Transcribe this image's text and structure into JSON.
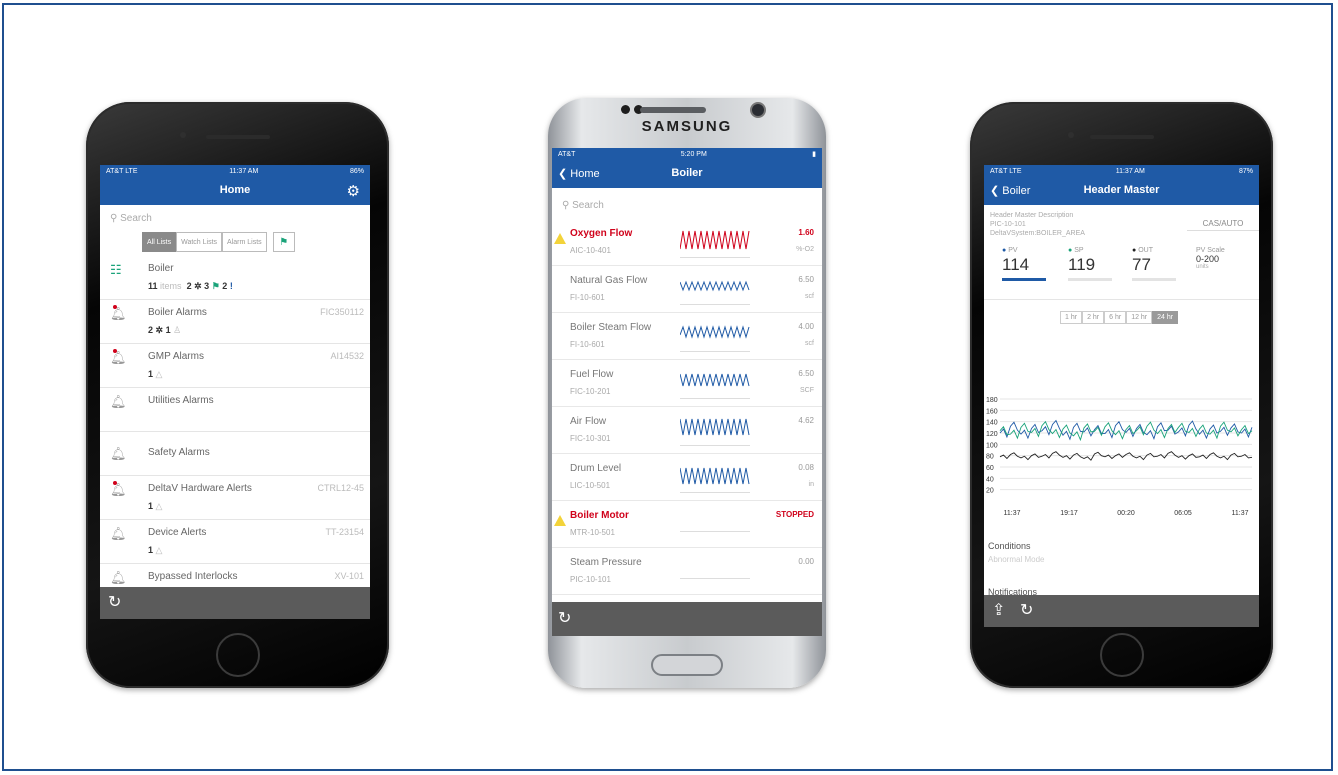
{
  "phone1": {
    "status": {
      "carrier": "AT&T LTE",
      "time": "11:37 AM",
      "battery": "86%"
    },
    "nav": {
      "title": "Home"
    },
    "search_placeholder": "Search",
    "tabs": [
      "All Lists",
      "Watch Lists",
      "Alarm Lists"
    ],
    "items": [
      {
        "name": "Boiler",
        "tag": "",
        "count": "11",
        "count_label": "items",
        "s1": "2",
        "s2": "3",
        "s3": "2"
      },
      {
        "name": "Boiler Alarms",
        "tag": "FIC350112",
        "s1": "2",
        "s2": "1"
      },
      {
        "name": "GMP Alarms",
        "tag": "AI14532",
        "s1": "1"
      },
      {
        "name": "Utilities Alarms",
        "tag": ""
      },
      {
        "name": "Safety Alarms",
        "tag": ""
      },
      {
        "name": "DeltaV Hardware Alerts",
        "tag": "CTRL12-45",
        "s1": "1"
      },
      {
        "name": "Device Alerts",
        "tag": "TT-23154",
        "s1": "1"
      },
      {
        "name": "Bypassed Interlocks",
        "tag": "XV-101"
      }
    ]
  },
  "phone2": {
    "brand": "SAMSUNG",
    "status": {
      "carrier": "AT&T",
      "time": "5:20 PM"
    },
    "nav": {
      "back": "Home",
      "title": "Boiler"
    },
    "search_placeholder": "Search",
    "rows": [
      {
        "name": "Oxygen Flow",
        "tag": "AIC-10-401",
        "value": "1.60",
        "unit": "%-O2",
        "alarm": true
      },
      {
        "name": "Natural Gas Flow",
        "tag": "FI-10-601",
        "value": "6.50",
        "unit": "scf"
      },
      {
        "name": "Boiler Steam Flow",
        "tag": "FI-10-601",
        "value": "4.00",
        "unit": "scf"
      },
      {
        "name": "Fuel Flow",
        "tag": "FIC-10-201",
        "value": "6.50",
        "unit": "SCF"
      },
      {
        "name": "Air Flow",
        "tag": "FIC-10-301",
        "value": "4.62",
        "unit": ""
      },
      {
        "name": "Drum Level",
        "tag": "LIC-10-501",
        "value": "0.08",
        "unit": "in"
      },
      {
        "name": "Boiler Motor",
        "tag": "MTR-10-501",
        "value": "STOPPED",
        "unit": "",
        "alarm": true
      },
      {
        "name": "Steam Pressure",
        "tag": "PIC-10-101",
        "value": "0.00",
        "unit": ""
      }
    ]
  },
  "phone3": {
    "status": {
      "carrier": "AT&T LTE",
      "time": "11:37 AM",
      "battery": "87%"
    },
    "nav": {
      "back": "Boiler",
      "title": "Header Master"
    },
    "desc": [
      "Header Master Description",
      "PIC-10-101",
      "DeltaVSystem:BOILER_AREA"
    ],
    "mode": "CAS/AUTO",
    "pv": {
      "label": "PV",
      "value": "114"
    },
    "sp": {
      "label": "SP",
      "value": "119"
    },
    "out": {
      "label": "OUT",
      "value": "77"
    },
    "scale": {
      "label": "PV Scale",
      "value": "0-200",
      "unit": "units"
    },
    "ranges": [
      "1 hr",
      "2 hr",
      "6 hr",
      "12 hr",
      "24 hr"
    ],
    "chart_data": {
      "type": "line",
      "y_ticks": [
        "180",
        "160",
        "140",
        "120",
        "100",
        "80",
        "60",
        "40",
        "20"
      ],
      "x_ticks": [
        "11:37",
        "19:17",
        "00:20",
        "06:05",
        "11:37"
      ],
      "ylim": [
        0,
        180
      ],
      "series": [
        {
          "values": [
            120,
            132,
            118,
            128,
            124,
            135,
            116,
            130,
            122,
            126,
            119,
            133,
            121,
            128,
            117,
            131,
            125,
            122,
            134,
            118,
            127,
            123,
            129,
            120,
            130
          ]
        },
        {
          "values": [
            124,
            118,
            130,
            121,
            133,
            119,
            127,
            115,
            129,
            123,
            131,
            117,
            126,
            124,
            132,
            119,
            128,
            130,
            121,
            127,
            118,
            132,
            122,
            126,
            124
          ]
        },
        {
          "values": [
            78,
            82,
            76,
            80,
            79,
            84,
            77,
            81,
            75,
            83,
            78,
            80,
            82,
            76,
            81,
            79,
            84,
            77,
            80,
            78,
            82,
            76,
            81,
            79,
            77
          ]
        }
      ]
    },
    "conditions_title": "Conditions",
    "conditions_value": "Abnormal Mode",
    "notifications_title": "Notifications",
    "colors": {
      "pv": "#1f5aa6",
      "sp": "#1aa37a",
      "out": "#222222"
    }
  }
}
